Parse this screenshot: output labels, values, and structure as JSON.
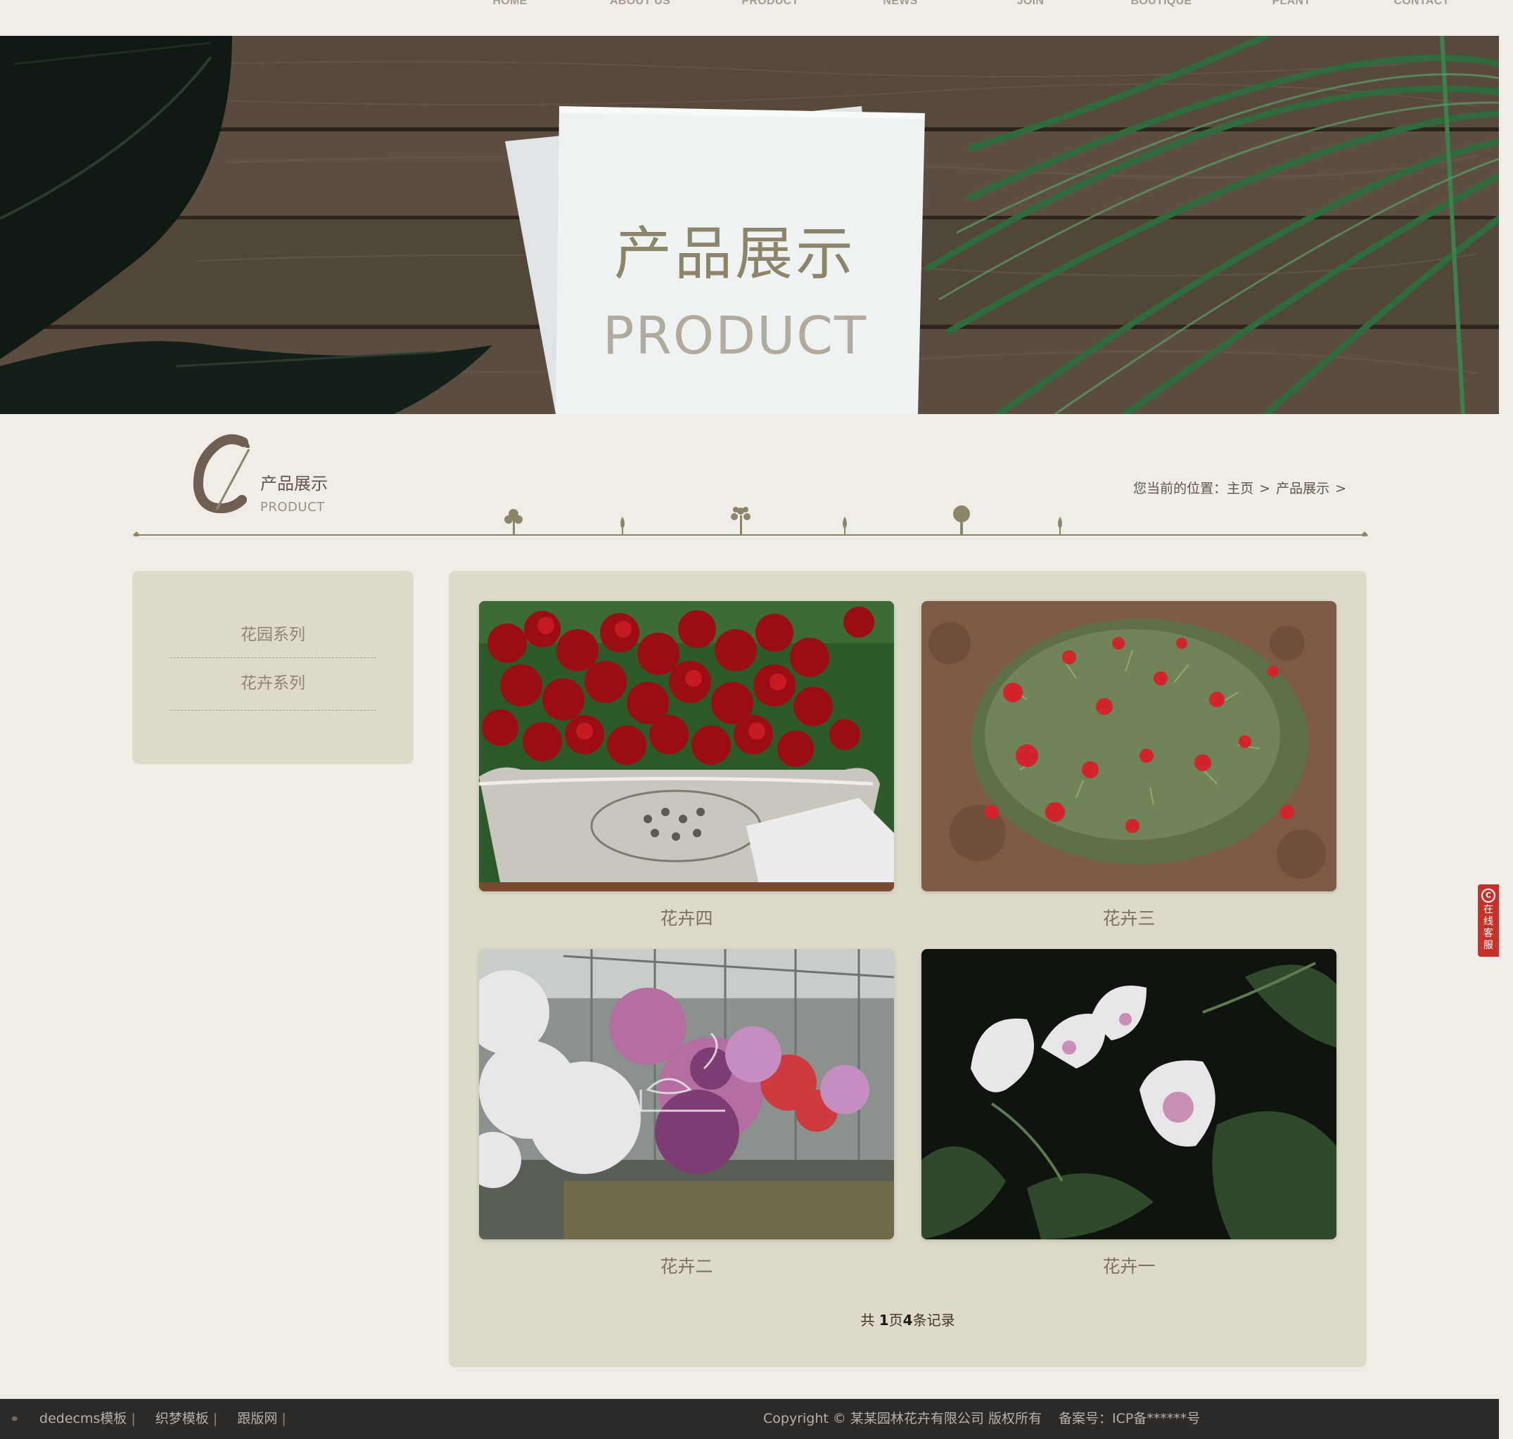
{
  "nav": {
    "items": [
      {
        "label": "HOME"
      },
      {
        "label": "ABOUT US"
      },
      {
        "label": "PRODUCT"
      },
      {
        "label": "NEWS"
      },
      {
        "label": "JOIN"
      },
      {
        "label": "BOUTIQUE"
      },
      {
        "label": "PLANT"
      },
      {
        "label": "CONTACT"
      }
    ]
  },
  "banner": {
    "title": "产品展示",
    "subtitle": "PRODUCT"
  },
  "section": {
    "logo_letter": "C",
    "title": "产品展示",
    "subtitle": "PRODUCT"
  },
  "breadcrumb": {
    "prefix": "您当前的位置：",
    "home": "主页",
    "current": "产品展示",
    "sep": ">"
  },
  "sidebar": {
    "items": [
      {
        "label": "花园系列"
      },
      {
        "label": "花卉系列"
      }
    ]
  },
  "products": [
    {
      "name": "花卉四",
      "image": "red pansies in basket"
    },
    {
      "name": "花卉三",
      "image": "red flowers ground cover"
    },
    {
      "name": "花卉二",
      "image": "hanging petunia baskets greenhouse"
    },
    {
      "name": "花卉一",
      "image": "white morning glory"
    }
  ],
  "pager": {
    "text_1": "共",
    "pages": "1",
    "text_2": "页",
    "records": "4",
    "text_3": "条记录"
  },
  "service": {
    "chars": [
      "在",
      "线",
      "客",
      "服"
    ]
  },
  "footer": {
    "links": [
      "dedecms模板",
      "织梦模板",
      "跟版网"
    ],
    "copyright": "Copyright © 某某园林花卉有限公司 版权所有",
    "icp": "备案号：ICP备******号"
  },
  "colors": {
    "page_bg": "#f0ede6",
    "panel_bg": "#dddac9",
    "footer_bg": "#2d2b29",
    "service_red": "#c8312a",
    "accent_olive": "#8d856a"
  }
}
